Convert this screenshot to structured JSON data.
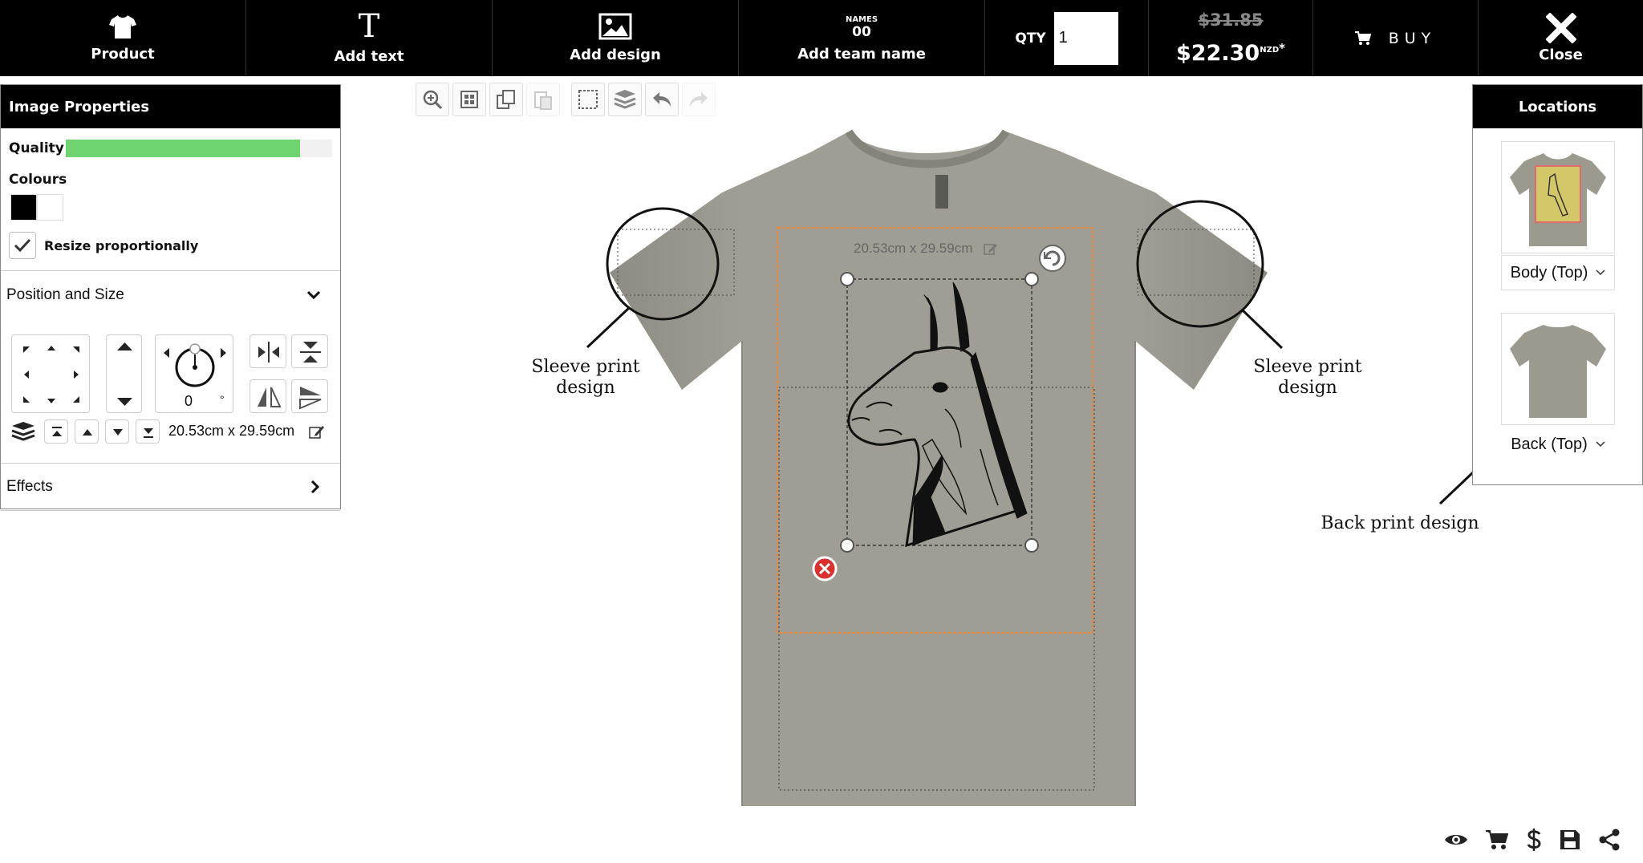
{
  "topbar": {
    "product_label": "Product",
    "add_text_label": "Add text",
    "add_design_label": "Add design",
    "names_word": "NAMES",
    "names_number": "00",
    "team_name_label": "Add team name",
    "qty_label": "QTY",
    "qty_value": "1",
    "price_old": "$31.85",
    "price_new": "$22.30",
    "price_currency": "NZD",
    "price_asterisk": "*",
    "buy_label": "BUY",
    "close_label": "Close"
  },
  "image_properties": {
    "title": "Image Properties",
    "quality_label": "Quality",
    "quality_fraction": 0.88,
    "colours_label": "Colours",
    "colours": [
      "#000000",
      "#ffffff"
    ],
    "resize_label": "Resize proportionally",
    "resize_checked": true,
    "position_size_label": "Position and Size",
    "rotation_value": "0",
    "rotation_unit": "°",
    "size_text": "20.53cm x 29.59cm",
    "effects_label": "Effects"
  },
  "canvas": {
    "shirt_color": "#9c9a8f",
    "design_size_label": "20.53cm x 29.59cm",
    "annotations": {
      "left_sleeve": [
        "Sleeve print",
        "design"
      ],
      "right_sleeve": [
        "Sleeve print",
        "design"
      ],
      "back": "Back print design"
    }
  },
  "locations": {
    "title": "Locations",
    "items": [
      {
        "label": "Body (Top)",
        "selected": true
      },
      {
        "label": "Back (Top)",
        "selected": false
      }
    ]
  },
  "bottom_icons": [
    "eye-icon",
    "cart-icon",
    "dollar-icon",
    "save-icon",
    "share-icon"
  ],
  "colors": {
    "accent_quality": "#6fd46f",
    "selection_orange": "#e8883a",
    "delete_red": "#d93030"
  }
}
